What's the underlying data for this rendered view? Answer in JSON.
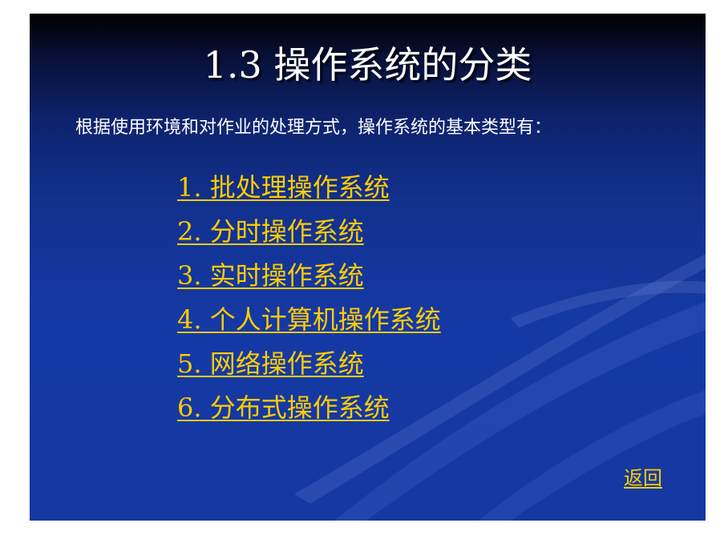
{
  "slide": {
    "title": "1.3 操作系统的分类",
    "subtitle": "根据使用环境和对作业的处理方式，操作系统的基本类型有：",
    "menu_items": [
      "1. 批处理操作系统",
      "2. 分时操作系统",
      "3. 实时操作系统",
      "4. 个人计算机操作系统",
      "5. 网络操作系统",
      "6. 分布式操作系统"
    ],
    "back_label": "返回"
  },
  "colors": {
    "background": "#1538a2",
    "title_text": "#ffffff",
    "link": "#ffcc00"
  }
}
